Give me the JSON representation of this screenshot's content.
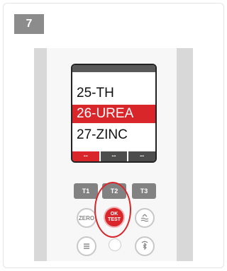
{
  "step": {
    "number": "7"
  },
  "screen": {
    "menu": [
      "25-TH",
      "26-UREA",
      "27-ZINC"
    ],
    "selected_index": 1,
    "softkeys": [
      "--",
      "--",
      "--"
    ]
  },
  "keys": {
    "t1": "T1",
    "t2": "T2",
    "t3": "T3",
    "zero": "ZERO",
    "ok_line1": "OK",
    "ok_line2": "TEST"
  },
  "icons": {
    "water_level": "water-level-icon",
    "menu": "menu-lines-icon",
    "bluetooth": "bluetooth-icon"
  },
  "colors": {
    "accent": "#d9262b",
    "badge": "#8c8c8c",
    "key": "#828282"
  }
}
